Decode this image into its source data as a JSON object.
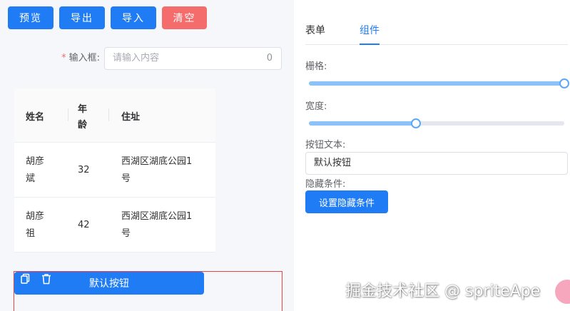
{
  "toolbar": {
    "preview": "预览",
    "export": "导出",
    "import": "导入",
    "clear": "清空"
  },
  "form": {
    "required_mark": "*",
    "input_label": "输入框:",
    "input_placeholder": "请输入内容",
    "input_count": "0"
  },
  "table": {
    "headers": [
      "姓名",
      "年龄",
      "住址"
    ],
    "rows": [
      {
        "name_line1": "胡彦",
        "name_line2": "斌",
        "age": "32",
        "addr_line1": "西湖区湖底公园1",
        "addr_line2": "号"
      },
      {
        "name_line1": "胡彦",
        "name_line2": "祖",
        "age": "42",
        "addr_line1": "西湖区湖底公园1",
        "addr_line2": "号"
      }
    ],
    "age_header_line1": "年",
    "age_header_line2": "龄"
  },
  "canvas_component": {
    "button_label": "默认按钮",
    "copy_icon": "copy-icon",
    "delete_icon": "trash-icon"
  },
  "panel": {
    "tabs": [
      {
        "label": "表单",
        "active": false
      },
      {
        "label": "组件",
        "active": true
      }
    ],
    "grid_label": "栅格:",
    "grid_value": 1.0,
    "width_label": "宽度:",
    "width_value": 0.42,
    "button_text_label": "按钮文本:",
    "button_text_value": "默认按钮",
    "hide_condition_label": "隐藏条件:",
    "hide_condition_button": "设置隐藏条件"
  },
  "watermark": "掘金技术社区 @ spriteApe",
  "colors": {
    "primary": "#1f7cf5",
    "danger": "#f56c6c",
    "selection_border": "#e64545",
    "slider_fill": "#8cc1fa"
  }
}
